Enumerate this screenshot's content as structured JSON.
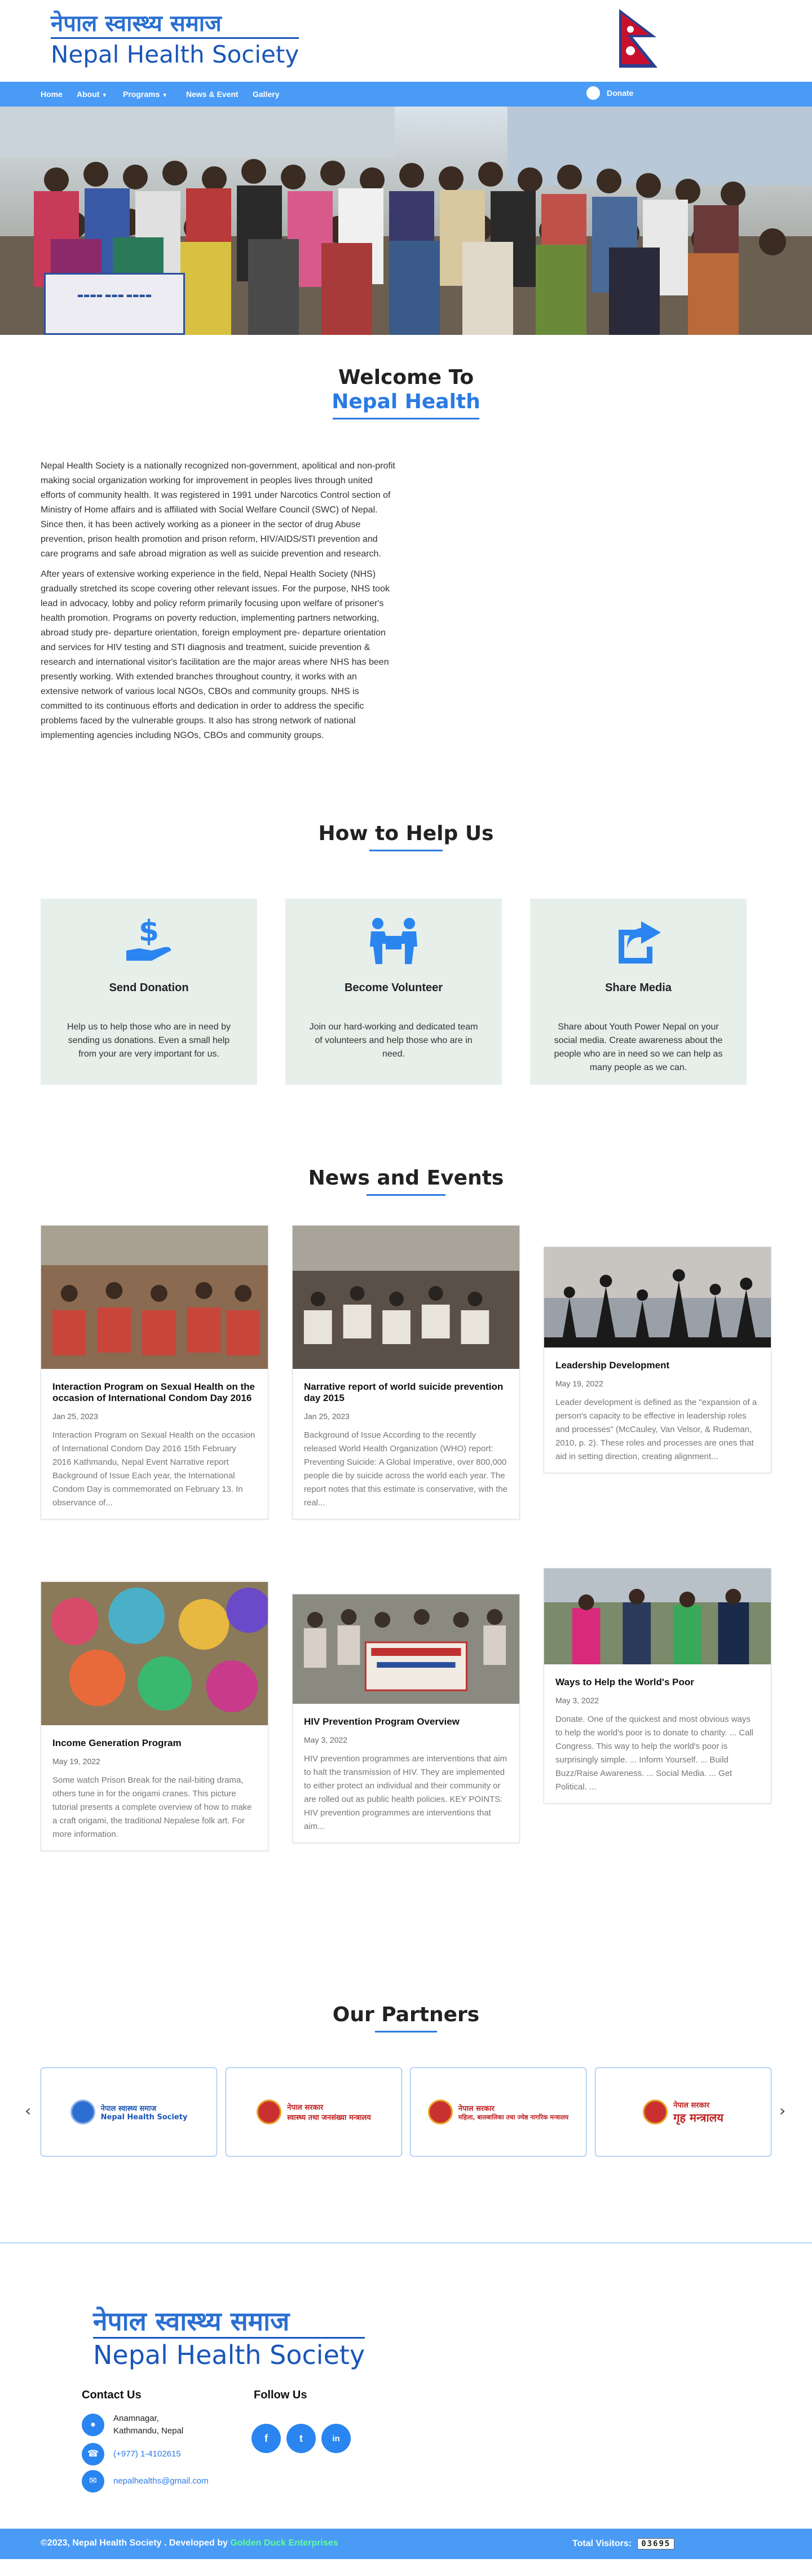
{
  "header": {
    "logo_nepali": "नेपाल स्वास्थ्य समाज",
    "logo_english": "Nepal Health Society",
    "flag": "nepal-flag"
  },
  "nav": {
    "items": [
      {
        "label": "Home"
      },
      {
        "label": "About",
        "dropdown": true
      },
      {
        "label": "Programs",
        "dropdown": true
      },
      {
        "label": "News & Event"
      },
      {
        "label": "Gallery"
      }
    ],
    "donate_label": "Donate",
    "accent": "#4a9bf5"
  },
  "welcome": {
    "line1": "Welcome To",
    "line2": "Nepal Health"
  },
  "about": {
    "p1": "Nepal Health Society is a nationally recognized non-government, apolitical and non-profit making social organization working for improvement in peoples lives through united efforts of community health. It was registered in 1991 under Narcotics Control section of Ministry of Home affairs and is affiliated with Social Welfare Council (SWC) of Nepal. Since then, it has been actively working as a pioneer in the sector of drug Abuse prevention, prison health promotion and prison reform, HIV/AIDS/STI prevention and care programs and safe abroad migration as well as suicide prevention and research.",
    "p2": "After years of extensive working experience in the field, Nepal Health Society (NHS) gradually stretched its scope covering other relevant issues. For the purpose, NHS took lead in advocacy, lobby and policy reform primarily focusing upon welfare of prisoner's health promotion. Programs on poverty reduction, implementing partners networking, abroad study pre- departure orientation, foreign employment pre- departure orientation and services for HIV testing and STI diagnosis and treatment, suicide prevention & research and international visitor's facilitation are the major areas where NHS has been presently working. With extended branches throughout country, it works with an extensive network of various local NGOs, CBOs and community groups. NHS is committed to its continuous efforts and dedication in order to address the specific problems faced by the vulnerable groups. It also has strong network of national implementing agencies including NGOs, CBOs and community groups."
  },
  "help": {
    "title": "How to Help Us",
    "cards": [
      {
        "title": "Send Donation",
        "text": "Help us to help those who are in need by sending us donations. Even a small help from your are very important for us.",
        "icon": "hand-dollar-icon"
      },
      {
        "title": "Become Volunteer",
        "text": "Join our hard-working and dedicated team of volunteers and help those who are in need.",
        "icon": "people-carry-icon"
      },
      {
        "title": "Share Media",
        "text": "Share about Youth Power Nepal on your social media. Create awareness about the people who are in need so we can help as many people as we can.",
        "icon": "share-icon"
      }
    ]
  },
  "news": {
    "title": "News and Events",
    "items": [
      {
        "title": "Interaction Program on Sexual Health on the occasion of International Condom Day 2016",
        "date": "Jan 25, 2023",
        "excerpt": "Interaction Program on Sexual Health on the occasion of International Condom Day 2016 15th February 2016 Kathmandu, Nepal Event Narrative report Background of Issue Each year, the International Condom Day is commemorated on February 13. In observance of..."
      },
      {
        "title": "Narrative report of world suicide prevention day 2015",
        "date": "Jan 25, 2023",
        "excerpt": "Background of Issue According to the recently released World Health Organization (WHO) report: Preventing Suicide: A Global Imperative, over 800,000 people die by suicide across the world each year. The report notes that this estimate is conservative, with the real..."
      },
      {
        "title": "Leadership Development",
        "date": "May 19, 2022",
        "excerpt": "Leader development is defined as the \"expansion of a person's capacity to be effective in leadership roles and processes\" (McCauley, Van Velsor, & Rudeman, 2010, p. 2). These roles and processes are ones that aid in setting direction, creating alignment..."
      },
      {
        "title": "Income Generation Program",
        "date": "May 19, 2022",
        "excerpt": "Some watch Prison Break for the nail-biting drama, others tune in for the origami cranes. This picture tutorial presents a complete overview of how to make a craft origami, the traditional Nepalese folk art. For more information."
      },
      {
        "title": "HIV Prevention Program Overview",
        "date": "May 3, 2022",
        "excerpt": "HIV prevention programmes are interventions that aim to halt the transmission of HIV. They are implemented to either protect an individual and their community or are rolled out as public health policies. KEY POINTS: HIV prevention programmes are interventions that aim..."
      },
      {
        "title": "Ways to Help the World's Poor",
        "date": "May 3, 2022",
        "excerpt": "Donate. One of the quickest and most obvious ways to help the world's poor is to donate to charity. ... Call Congress. This way to help the world's poor is surprisingly simple. ... Inform Yourself. ... Build Buzz/Raise Awareness. ... Social Media. ... Get Political. ..."
      }
    ]
  },
  "partners": {
    "title": "Our Partners",
    "items": [
      {
        "line1": "नेपाल स्वास्थ्य समाज",
        "line2": "Nepal Health Society"
      },
      {
        "line1": "नेपाल सरकार",
        "line2": "स्वास्थ्य तथा जनसंख्या मन्त्रालय"
      },
      {
        "line1": "नेपाल सरकार",
        "line2": "महिला, बालबालिका तथा ज्येष्ठ नागरिक मन्त्रालय"
      },
      {
        "line1": "नेपाल सरकार",
        "line2": "गृह मन्त्रालय"
      }
    ]
  },
  "footer": {
    "logo_nepali": "नेपाल स्वास्थ्य समाज",
    "logo_english": "Nepal Health Society",
    "contact_title": "Contact Us",
    "address1": "Anamnagar,",
    "address2": "Kathmandu, Nepal",
    "phone": "(+977) 1-4102615",
    "email": "nepalhealths@gmail.com",
    "follow_title": "Follow Us",
    "social": [
      "f",
      "t",
      "in"
    ],
    "copyright": "©2023, Nepal Health Society . Developed by",
    "developer": "Golden Duck Enterprises",
    "visitors_label": "Total Visitors:",
    "visitors_count": "03695"
  }
}
